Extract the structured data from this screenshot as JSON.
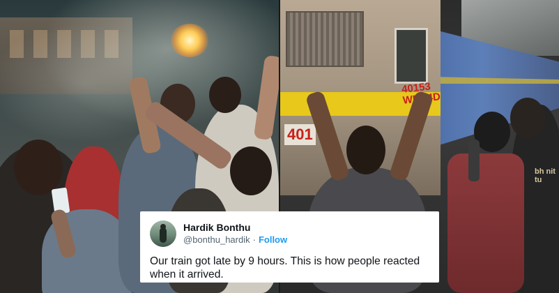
{
  "tweet": {
    "display_name": "Hardik Bonthu",
    "handle": "@bonthu_hardik",
    "separator": "·",
    "follow_label": "Follow",
    "text": "Our train got late by 9 hours. This is how people reacted when it arrived."
  },
  "photo_right": {
    "loco_number_lines": [
      "40153",
      "WDP4D"
    ],
    "loco_front_number": "401",
    "tshirt_text": "bh nit tu"
  },
  "colors": {
    "follow_link": "#1d9bf0",
    "name_text": "#0f1419",
    "handle_text": "#536471",
    "loco_stripe": "#e8c81a",
    "coach_blue": "#4d6ea8"
  }
}
